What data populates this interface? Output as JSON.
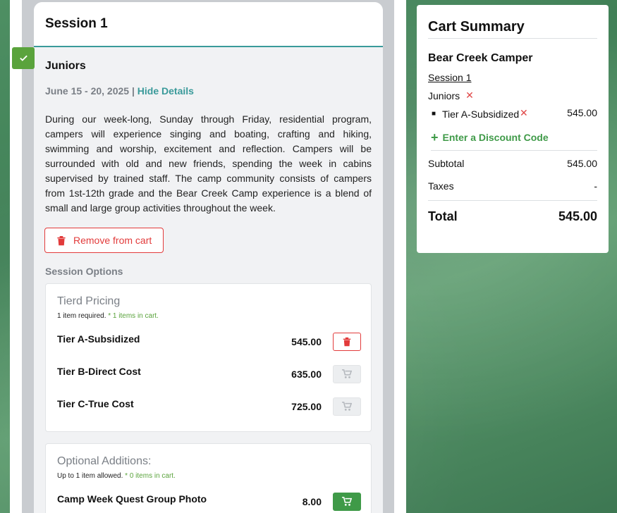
{
  "session": {
    "title": "Session 1",
    "camp_name": "Juniors",
    "dates": "June 15 - 20, 2025",
    "separator": " | ",
    "hide_details": "Hide Details",
    "description": "During our week-long, Sunday through Friday, residential program, campers will experience singing and boating, crafting and hiking, swimming and worship, excitement and reflection. Campers will be surrounded with old and new friends, spending the week in cabins supervised by trained staff. The camp community consists of campers from 1st-12th grade and the Bear Creek Camp experience is a blend of small and large group activities throughout the week.",
    "remove_label": "Remove from cart",
    "options_label": "Session Options"
  },
  "tiered": {
    "title": "Tierd Pricing",
    "requirement": "1 item required.",
    "in_cart": "* 1 items in cart.",
    "items": [
      {
        "name": "Tier A-Subsidized",
        "price": "545.00",
        "state": "in-cart"
      },
      {
        "name": "Tier B-Direct Cost",
        "price": "635.00",
        "state": "disabled"
      },
      {
        "name": "Tier C-True Cost",
        "price": "725.00",
        "state": "disabled"
      }
    ]
  },
  "optional": {
    "title": "Optional Additions:",
    "requirement": "Up to 1 item allowed.",
    "in_cart": "* 0 items in cart.",
    "items": [
      {
        "name": "Camp Week Quest Group Photo",
        "price": "8.00",
        "state": "available"
      }
    ]
  },
  "cart": {
    "title": "Cart Summary",
    "camper": "Bear Creek Camper",
    "session": "Session 1",
    "camp_name": "Juniors",
    "item_name": "Tier A-Subsidized",
    "item_amount": "545.00",
    "discount_label": "Enter a Discount Code",
    "subtotal_label": "Subtotal",
    "subtotal_value": "545.00",
    "taxes_label": "Taxes",
    "taxes_value": "-",
    "total_label": "Total",
    "total_value": "545.00"
  },
  "colors": {
    "accent_teal": "#3a9a9a",
    "danger_red": "#e23b3b",
    "success_green": "#3f9a48",
    "check_green": "#5aa33c"
  },
  "icons": {
    "check": "check-icon",
    "trash": "trash-icon",
    "cart_add": "cart-add-icon",
    "remove": "remove-x-icon",
    "plus": "plus-icon"
  }
}
